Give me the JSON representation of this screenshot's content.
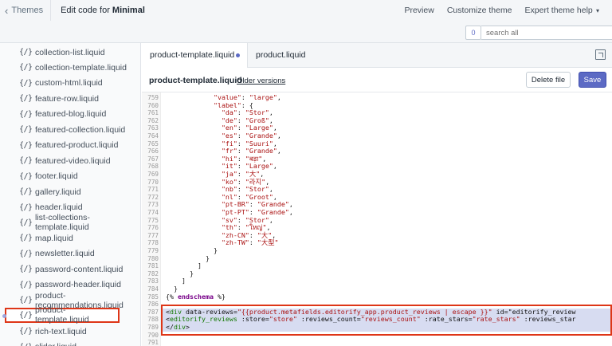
{
  "topbar": {
    "back_label": "Themes",
    "title_prefix": "Edit code for ",
    "theme_name": "Minimal",
    "links": [
      "Preview",
      "Customize theme",
      "Expert theme help"
    ]
  },
  "search": {
    "count": "0",
    "placeholder": "search all"
  },
  "sidebar": {
    "icon_glyph": "{/}",
    "files": [
      "collection-list.liquid",
      "collection-template.liquid",
      "custom-html.liquid",
      "feature-row.liquid",
      "featured-blog.liquid",
      "featured-collection.liquid",
      "featured-product.liquid",
      "featured-video.liquid",
      "footer.liquid",
      "gallery.liquid",
      "header.liquid",
      "list-collections-template.liquid",
      "map.liquid",
      "newsletter.liquid",
      "password-content.liquid",
      "password-header.liquid",
      "product-recommendations.liquid",
      "product-template.liquid",
      "rich-text.liquid",
      "slider.liquid"
    ],
    "active_index": 17
  },
  "editor": {
    "tabs": [
      "product-template.liquid",
      "product.liquid"
    ],
    "file_name": "product-template.liquid",
    "older_versions": "Older versions",
    "delete_label": "Delete file",
    "save_label": "Save",
    "lines": [
      {
        "n": "759",
        "t": "            \"value\": \"large\","
      },
      {
        "n": "760",
        "t": "            \"label\": {"
      },
      {
        "n": "761",
        "t": "              \"da\": \"Stor\","
      },
      {
        "n": "762",
        "t": "              \"de\": \"Groß\","
      },
      {
        "n": "763",
        "t": "              \"en\": \"Large\","
      },
      {
        "n": "764",
        "t": "              \"es\": \"Grande\","
      },
      {
        "n": "765",
        "t": "              \"fi\": \"Suuri\","
      },
      {
        "n": "766",
        "t": "              \"fr\": \"Grande\","
      },
      {
        "n": "767",
        "t": "              \"hi\": \"बड़ा\","
      },
      {
        "n": "768",
        "t": "              \"it\": \"Large\","
      },
      {
        "n": "769",
        "t": "              \"ja\": \"大\","
      },
      {
        "n": "770",
        "t": "              \"ko\": \"라지\","
      },
      {
        "n": "771",
        "t": "              \"nb\": \"Stor\","
      },
      {
        "n": "772",
        "t": "              \"nl\": \"Groot\","
      },
      {
        "n": "773",
        "t": "              \"pt-BR\": \"Grande\","
      },
      {
        "n": "774",
        "t": "              \"pt-PT\": \"Grande\","
      },
      {
        "n": "775",
        "t": "              \"sv\": \"Stor\","
      },
      {
        "n": "776",
        "t": "              \"th\": \"ใหญ่\","
      },
      {
        "n": "777",
        "t": "              \"zh-CN\": \"大\","
      },
      {
        "n": "778",
        "t": "              \"zh-TW\": \"大型\""
      },
      {
        "n": "779",
        "t": "            }"
      },
      {
        "n": "780",
        "t": "          }"
      },
      {
        "n": "781",
        "t": "        ]"
      },
      {
        "n": "782",
        "t": "      }"
      },
      {
        "n": "783",
        "t": "    ]"
      },
      {
        "n": "784",
        "t": "  }"
      },
      {
        "n": "785",
        "t": "{% endschema %}"
      },
      {
        "n": "786",
        "t": ""
      },
      {
        "n": "787",
        "t": "<div data-reviews=\"{{product.metafields.editorify_app.product_reviews | escape }}\" id=\"editorify_review"
      },
      {
        "n": "788",
        "t": "<editorify_reviews :store=\"store\" :reviews_count=\"reviews_count\" :rate_stars=\"rate_stars\" :reviews_star"
      },
      {
        "n": "789",
        "t": "</div>"
      },
      {
        "n": "790",
        "t": ""
      },
      {
        "n": "791",
        "t": ""
      }
    ]
  }
}
